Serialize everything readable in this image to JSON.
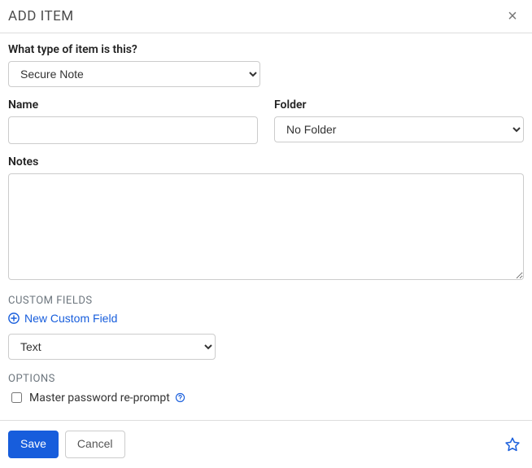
{
  "header": {
    "title": "ADD ITEM"
  },
  "form": {
    "type_label": "What type of item is this?",
    "type_value": "Secure Note",
    "name_label": "Name",
    "name_value": "",
    "folder_label": "Folder",
    "folder_value": "No Folder",
    "notes_label": "Notes",
    "notes_value": ""
  },
  "custom_fields": {
    "heading": "CUSTOM FIELDS",
    "new_label": "New Custom Field",
    "type_value": "Text"
  },
  "options": {
    "heading": "OPTIONS",
    "reprompt_label": "Master password re-prompt",
    "reprompt_checked": false
  },
  "footer": {
    "save_label": "Save",
    "cancel_label": "Cancel"
  },
  "colors": {
    "accent": "#175ddc"
  }
}
